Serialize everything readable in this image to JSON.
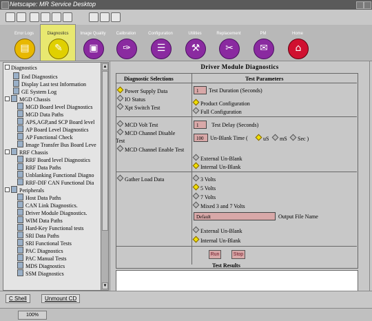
{
  "window": {
    "title": "Netscape: MR Service Desktop"
  },
  "nav": [
    {
      "label": "Error Logs",
      "icon": "error-logs-icon",
      "glyph": "▤"
    },
    {
      "label": "Diagnostics",
      "icon": "diagnostics-icon",
      "glyph": "✎"
    },
    {
      "label": "Image Quality",
      "icon": "image-quality-icon",
      "glyph": "▣"
    },
    {
      "label": "Calibration",
      "icon": "calibration-icon",
      "glyph": "✑"
    },
    {
      "label": "Configuration",
      "icon": "configuration-icon",
      "glyph": "☰"
    },
    {
      "label": "Utilities",
      "icon": "utilities-icon",
      "glyph": "⚒"
    },
    {
      "label": "Replacement",
      "icon": "replacement-icon",
      "glyph": "✂"
    },
    {
      "label": "PM",
      "icon": "pm-icon",
      "glyph": "✉"
    },
    {
      "label": "Home",
      "icon": "home-icon",
      "glyph": "⌂"
    }
  ],
  "tree": {
    "items": [
      "Diagnostics",
      "End Diagnostics",
      "Display Last test Information",
      "GE System Log",
      "MGD Chassis",
      "MGD Board level Diagnostics",
      "MGD Data Paths",
      "APS,AGP,and SCP Board level",
      "AP Board Level Diagnostics",
      "AP Functional Check",
      "Image Transfer Bus Board Leve",
      "RRF Chassis",
      "RRF Board level Diagnostics",
      "RRF Data Paths",
      "Unblanking Functional Diagno",
      "RRF-DIF CAN Functional Dia",
      "Peripherals",
      "Host Data Paths",
      "CAN Link Diagnostics.",
      "Driver Module Diagnostics.",
      "WIM Data Paths",
      "Hard-Key Functional tests",
      "SRI Data Paths",
      "SRI Functional Tests",
      "PAC Diagnostics",
      "PAC Manual Tests",
      "MDS Diagnostics",
      "SSM Diagnostics"
    ]
  },
  "main": {
    "title": "Driver Module Diagnostics",
    "col1_header": "Diagnostic Selections",
    "col2_header": "Test Parameters",
    "sec1": {
      "options": [
        "Power Supply Data",
        "IO Status",
        "Xpt Switch Test"
      ],
      "duration_value": "1",
      "duration_label": "Test Duration (Seconds)",
      "config_options": [
        "Product Configuration",
        "Full Configuration"
      ]
    },
    "sec2": {
      "options": [
        "MCD Volt Test",
        "MCD Channel Disable",
        "Test",
        "MCD Channel Enable Test"
      ],
      "delay_value": "1",
      "delay_label": "Test Delay (Seconds)",
      "unblank_value": "100",
      "unblank_label": "Un-Blank Time (",
      "units": [
        "uS",
        "mS",
        "Sec )"
      ],
      "blank_options": [
        "External Un-Blank",
        "Internal Un-Blank"
      ]
    },
    "sec3": {
      "option": "Gather Load Data",
      "volts": [
        "3 Volts",
        "5 Volts",
        "7 Volts",
        "Mixed 3 and 7 Volts"
      ],
      "file_value": "Default",
      "file_label": "Output File Name",
      "blank_options": [
        "External Un-Blank",
        "Internal Un-Blank"
      ]
    },
    "run_label": "Run",
    "stop_label": "Stop",
    "results_label": "Test Results"
  },
  "bottom": {
    "tab1": "C Shell",
    "tab2": "Unmount CD"
  },
  "status": {
    "progress": "100%"
  }
}
